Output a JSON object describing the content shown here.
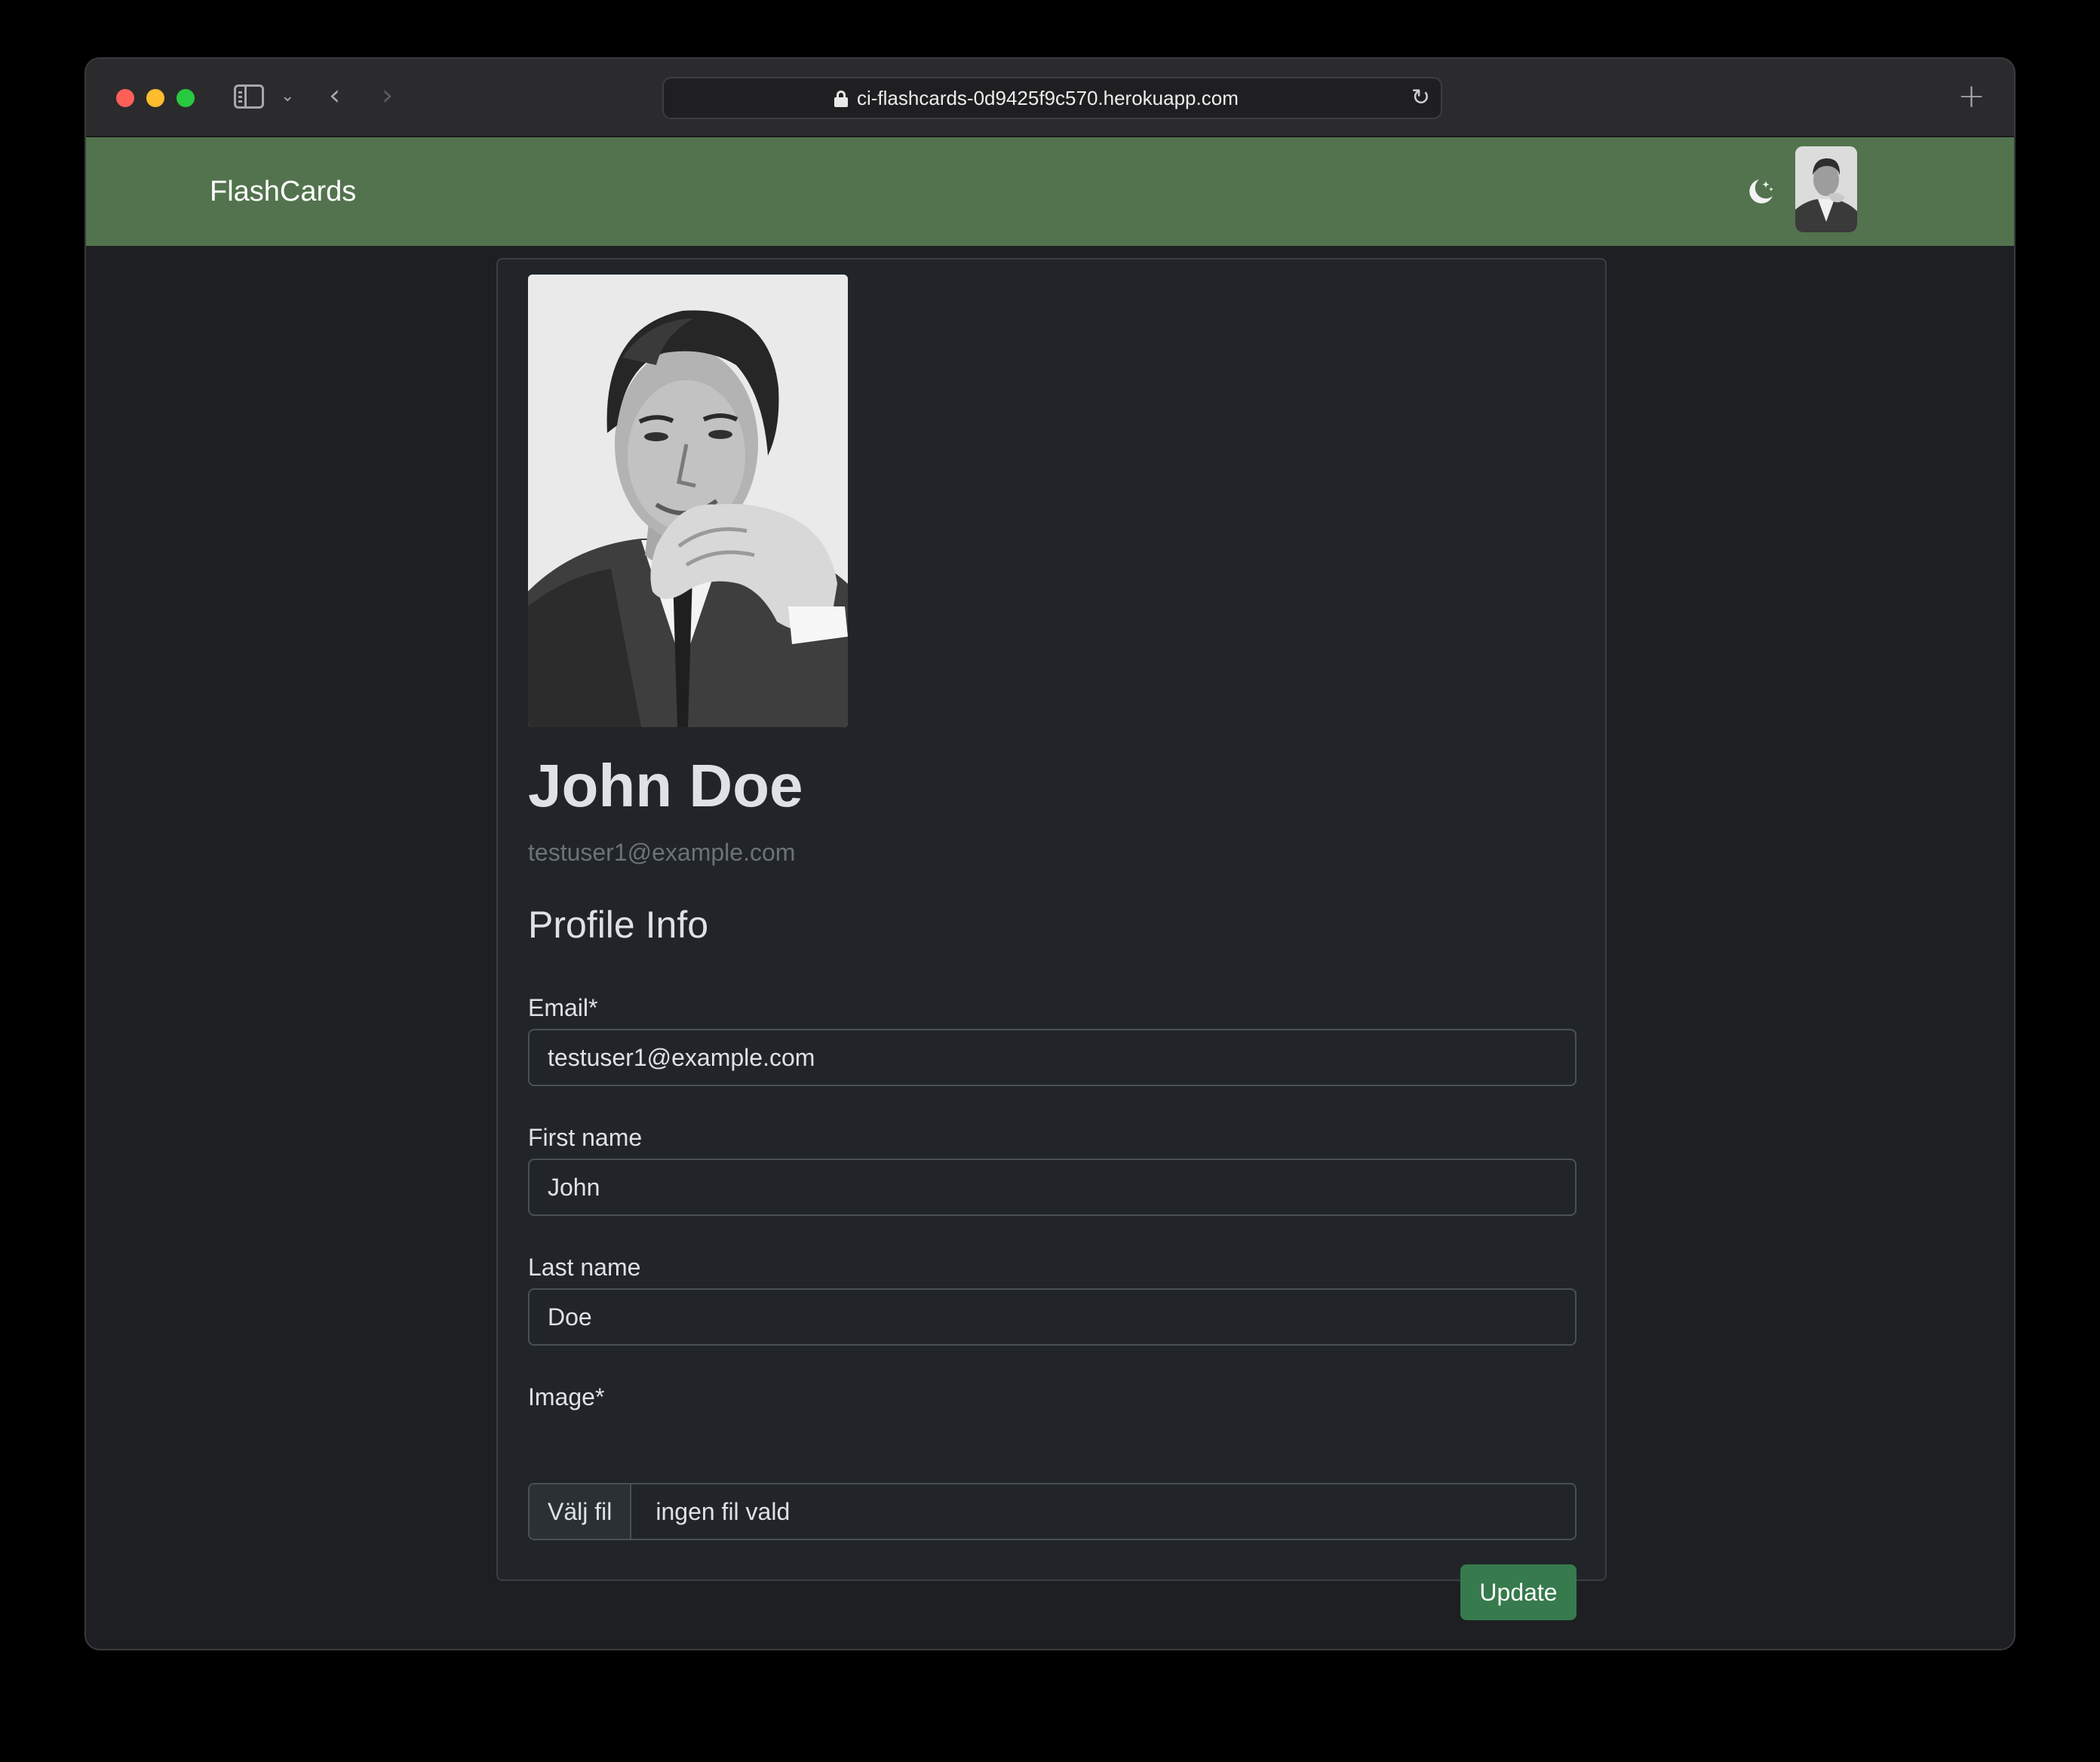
{
  "browser": {
    "url": "ci-flashcards-0d9425f9c570.herokuapp.com",
    "new_tab_symbol": "+"
  },
  "navbar": {
    "brand": "FlashCards",
    "theme_toggle_icon": "moon-stars-icon",
    "avatar_icon": "user-avatar"
  },
  "profile": {
    "name": "John Doe",
    "email": "testuser1@example.com",
    "section_title": "Profile Info"
  },
  "form": {
    "email": {
      "label": "Email*",
      "value": "testuser1@example.com"
    },
    "first_name": {
      "label": "First name",
      "value": "John"
    },
    "last_name": {
      "label": "Last name",
      "value": "Doe"
    },
    "image": {
      "label": "Image*",
      "button": "Välj fil",
      "status": "ingen fil vald"
    },
    "submit_label": "Update"
  },
  "colors": {
    "navbar": "#52734d",
    "page_background": "#212529",
    "primary_button": "#367a4d"
  }
}
